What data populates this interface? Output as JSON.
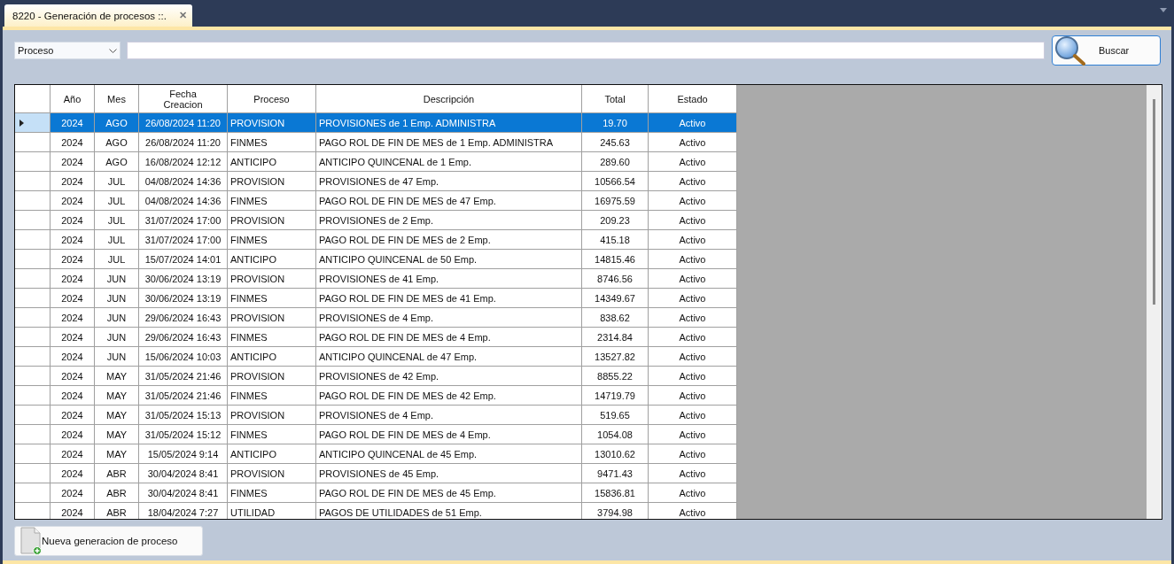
{
  "tab": {
    "title": "8220 - Generación de procesos ::.",
    "close": "✕",
    "selected": true
  },
  "filter": {
    "field": "Proceso",
    "search_button": "Buscar"
  },
  "table": {
    "columns": [
      "Año",
      "Mes",
      "Fecha Creacion",
      "Proceso",
      "Descripción",
      "Total",
      "Estado"
    ],
    "rows": [
      {
        "selected": true,
        "cells": [
          "2024",
          "AGO",
          "26/08/2024 11:20",
          "PROVISION",
          "PROVISIONES de 1 Emp. ADMINISTRA",
          "19.70",
          "Activo"
        ]
      },
      {
        "selected": false,
        "cells": [
          "2024",
          "AGO",
          "26/08/2024 11:20",
          "FINMES",
          "PAGO ROL DE FIN DE MES de 1 Emp. ADMINISTRA",
          "245.63",
          "Activo"
        ]
      },
      {
        "selected": false,
        "cells": [
          "2024",
          "AGO",
          "16/08/2024 12:12",
          "ANTICIPO",
          "ANTICIPO QUINCENAL de 1 Emp.",
          "289.60",
          "Activo"
        ]
      },
      {
        "selected": false,
        "cells": [
          "2024",
          "JUL",
          "04/08/2024 14:36",
          "PROVISION",
          "PROVISIONES de 47 Emp.",
          "10566.54",
          "Activo"
        ]
      },
      {
        "selected": false,
        "cells": [
          "2024",
          "JUL",
          "04/08/2024 14:36",
          "FINMES",
          "PAGO ROL DE FIN DE MES de 47 Emp.",
          "16975.59",
          "Activo"
        ]
      },
      {
        "selected": false,
        "cells": [
          "2024",
          "JUL",
          "31/07/2024 17:00",
          "PROVISION",
          "PROVISIONES de 2 Emp.",
          "209.23",
          "Activo"
        ]
      },
      {
        "selected": false,
        "cells": [
          "2024",
          "JUL",
          "31/07/2024 17:00",
          "FINMES",
          "PAGO ROL DE FIN DE MES de 2 Emp.",
          "415.18",
          "Activo"
        ]
      },
      {
        "selected": false,
        "cells": [
          "2024",
          "JUL",
          "15/07/2024 14:01",
          "ANTICIPO",
          "ANTICIPO QUINCENAL de 50 Emp.",
          "14815.46",
          "Activo"
        ]
      },
      {
        "selected": false,
        "cells": [
          "2024",
          "JUN",
          "30/06/2024 13:19",
          "PROVISION",
          "PROVISIONES de 41 Emp.",
          "8746.56",
          "Activo"
        ]
      },
      {
        "selected": false,
        "cells": [
          "2024",
          "JUN",
          "30/06/2024 13:19",
          "FINMES",
          "PAGO ROL DE FIN DE MES de 41 Emp.",
          "14349.67",
          "Activo"
        ]
      },
      {
        "selected": false,
        "cells": [
          "2024",
          "JUN",
          "29/06/2024 16:43",
          "PROVISION",
          "PROVISIONES de 4 Emp.",
          "838.62",
          "Activo"
        ]
      },
      {
        "selected": false,
        "cells": [
          "2024",
          "JUN",
          "29/06/2024 16:43",
          "FINMES",
          "PAGO ROL DE FIN DE MES de 4 Emp.",
          "2314.84",
          "Activo"
        ]
      },
      {
        "selected": false,
        "cells": [
          "2024",
          "JUN",
          "15/06/2024 10:03",
          "ANTICIPO",
          "ANTICIPO QUINCENAL de 47 Emp.",
          "13527.82",
          "Activo"
        ]
      },
      {
        "selected": false,
        "cells": [
          "2024",
          "MAY",
          "31/05/2024 21:46",
          "PROVISION",
          "PROVISIONES de 42 Emp.",
          "8855.22",
          "Activo"
        ]
      },
      {
        "selected": false,
        "cells": [
          "2024",
          "MAY",
          "31/05/2024 21:46",
          "FINMES",
          "PAGO ROL DE FIN DE MES de 42 Emp.",
          "14719.79",
          "Activo"
        ]
      },
      {
        "selected": false,
        "cells": [
          "2024",
          "MAY",
          "31/05/2024 15:13",
          "PROVISION",
          "PROVISIONES de 4 Emp.",
          "519.65",
          "Activo"
        ]
      },
      {
        "selected": false,
        "cells": [
          "2024",
          "MAY",
          "31/05/2024 15:12",
          "FINMES",
          "PAGO ROL DE FIN DE MES de 4 Emp.",
          "1054.08",
          "Activo"
        ]
      },
      {
        "selected": false,
        "cells": [
          "2024",
          "MAY",
          "15/05/2024 9:14",
          "ANTICIPO",
          "ANTICIPO QUINCENAL de 45 Emp.",
          "13010.62",
          "Activo"
        ]
      },
      {
        "selected": false,
        "cells": [
          "2024",
          "ABR",
          "30/04/2024 8:41",
          "PROVISION",
          "PROVISIONES de 45 Emp.",
          "9471.43",
          "Activo"
        ]
      },
      {
        "selected": false,
        "cells": [
          "2024",
          "ABR",
          "30/04/2024 8:41",
          "FINMES",
          "PAGO ROL DE FIN DE MES de 45 Emp.",
          "15836.81",
          "Activo"
        ]
      },
      {
        "selected": false,
        "cells": [
          "2024",
          "ABR",
          "18/04/2024 7:27",
          "UTILIDAD",
          "PAGOS DE UTILIDADES de 51 Emp.",
          "3794.98",
          "Activo"
        ]
      }
    ]
  },
  "new_button": "Nueva generacion de proceso"
}
